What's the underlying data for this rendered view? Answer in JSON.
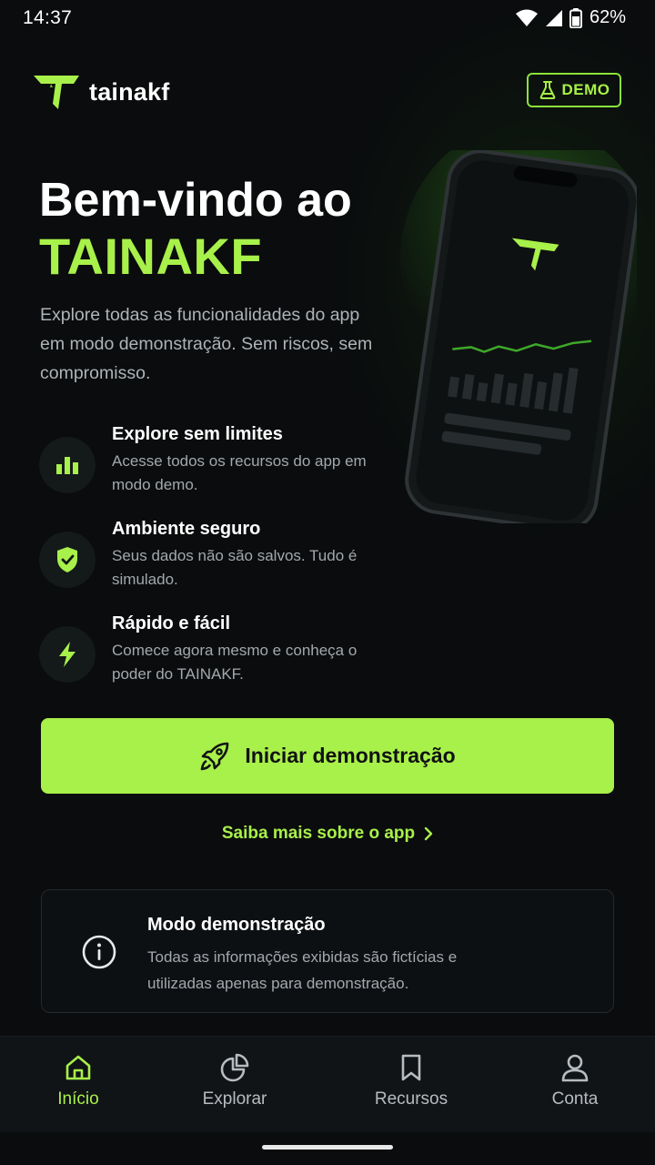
{
  "status_bar": {
    "time": "14:37",
    "battery": "62%"
  },
  "header": {
    "brand": "tainakf",
    "demo_badge": "DEMO"
  },
  "hero": {
    "title": "Bem-vindo ao",
    "brand": "TAINAKF",
    "description": "Explore todas as funcionalidades do app em modo demonstração. Sem riscos, sem compromisso."
  },
  "features": [
    {
      "icon": "bar-chart-icon",
      "title": "Explore sem limites",
      "description": "Acesse todos os recursos do app em modo demo."
    },
    {
      "icon": "shield-check-icon",
      "title": "Ambiente seguro",
      "description": "Seus dados não são salvos. Tudo é simulado."
    },
    {
      "icon": "lightning-icon",
      "title": "Rápido e fácil",
      "description": "Comece agora mesmo e conheça o poder do TAINAKF."
    }
  ],
  "cta": {
    "label": "Iniciar demonstração",
    "icon": "rocket-icon"
  },
  "learn_more": {
    "label": "Saiba mais sobre o app"
  },
  "info_card": {
    "title": "Modo demonstração",
    "text": "Todas as informações exibidas são fictícias e utilizadas apenas para demonstração."
  },
  "bottom_nav": [
    {
      "label": "Início",
      "icon": "home-icon",
      "active": true
    },
    {
      "label": "Explorar",
      "icon": "pie-chart-icon",
      "active": false
    },
    {
      "label": "Recursos",
      "icon": "bookmark-icon",
      "active": false
    },
    {
      "label": "Conta",
      "icon": "user-icon",
      "active": false
    }
  ],
  "colors": {
    "accent": "#a8f04a",
    "background": "#0a0c0d",
    "text_muted": "#a3a8ad"
  }
}
